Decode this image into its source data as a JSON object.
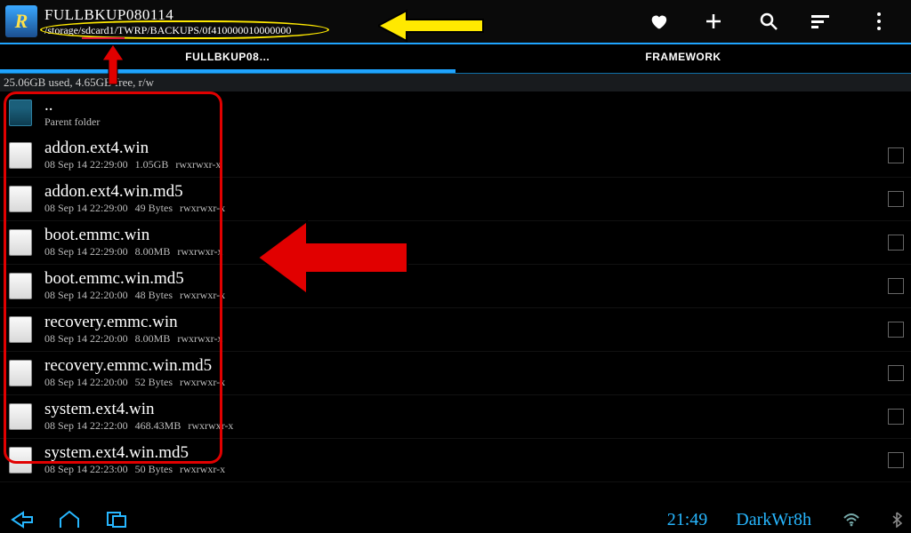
{
  "header": {
    "title": "FULLBKUP080114",
    "path": "/storage/sdcard1/TWRP/BACKUPS/0f410000010000000"
  },
  "tabs": {
    "left": "FULLBKUP08…",
    "right": "FRAMEWORK"
  },
  "storage_status": "25.06GB used, 4.65GB free, r/w",
  "parent": {
    "dots": "..",
    "label": "Parent folder"
  },
  "files": [
    {
      "name": "addon.ext4.win",
      "date": "08 Sep 14 22:29:00",
      "size": "1.05GB",
      "perm": "rwxrwxr-x"
    },
    {
      "name": "addon.ext4.win.md5",
      "date": "08 Sep 14 22:29:00",
      "size": "49 Bytes",
      "perm": "rwxrwxr-x"
    },
    {
      "name": "boot.emmc.win",
      "date": "08 Sep 14 22:29:00",
      "size": "8.00MB",
      "perm": "rwxrwxr-x"
    },
    {
      "name": "boot.emmc.win.md5",
      "date": "08 Sep 14 22:20:00",
      "size": "48 Bytes",
      "perm": "rwxrwxr-x"
    },
    {
      "name": "recovery.emmc.win",
      "date": "08 Sep 14 22:20:00",
      "size": "8.00MB",
      "perm": "rwxrwxr-x"
    },
    {
      "name": "recovery.emmc.win.md5",
      "date": "08 Sep 14 22:20:00",
      "size": "52 Bytes",
      "perm": "rwxrwxr-x"
    },
    {
      "name": "system.ext4.win",
      "date": "08 Sep 14 22:22:00",
      "size": "468.43MB",
      "perm": "rwxrwxr-x"
    },
    {
      "name": "system.ext4.win.md5",
      "date": "08 Sep 14 22:23:00",
      "size": "50 Bytes",
      "perm": "rwxrwxr-x"
    }
  ],
  "navbar": {
    "time": "21:49",
    "brand": "DarkWr8h"
  }
}
